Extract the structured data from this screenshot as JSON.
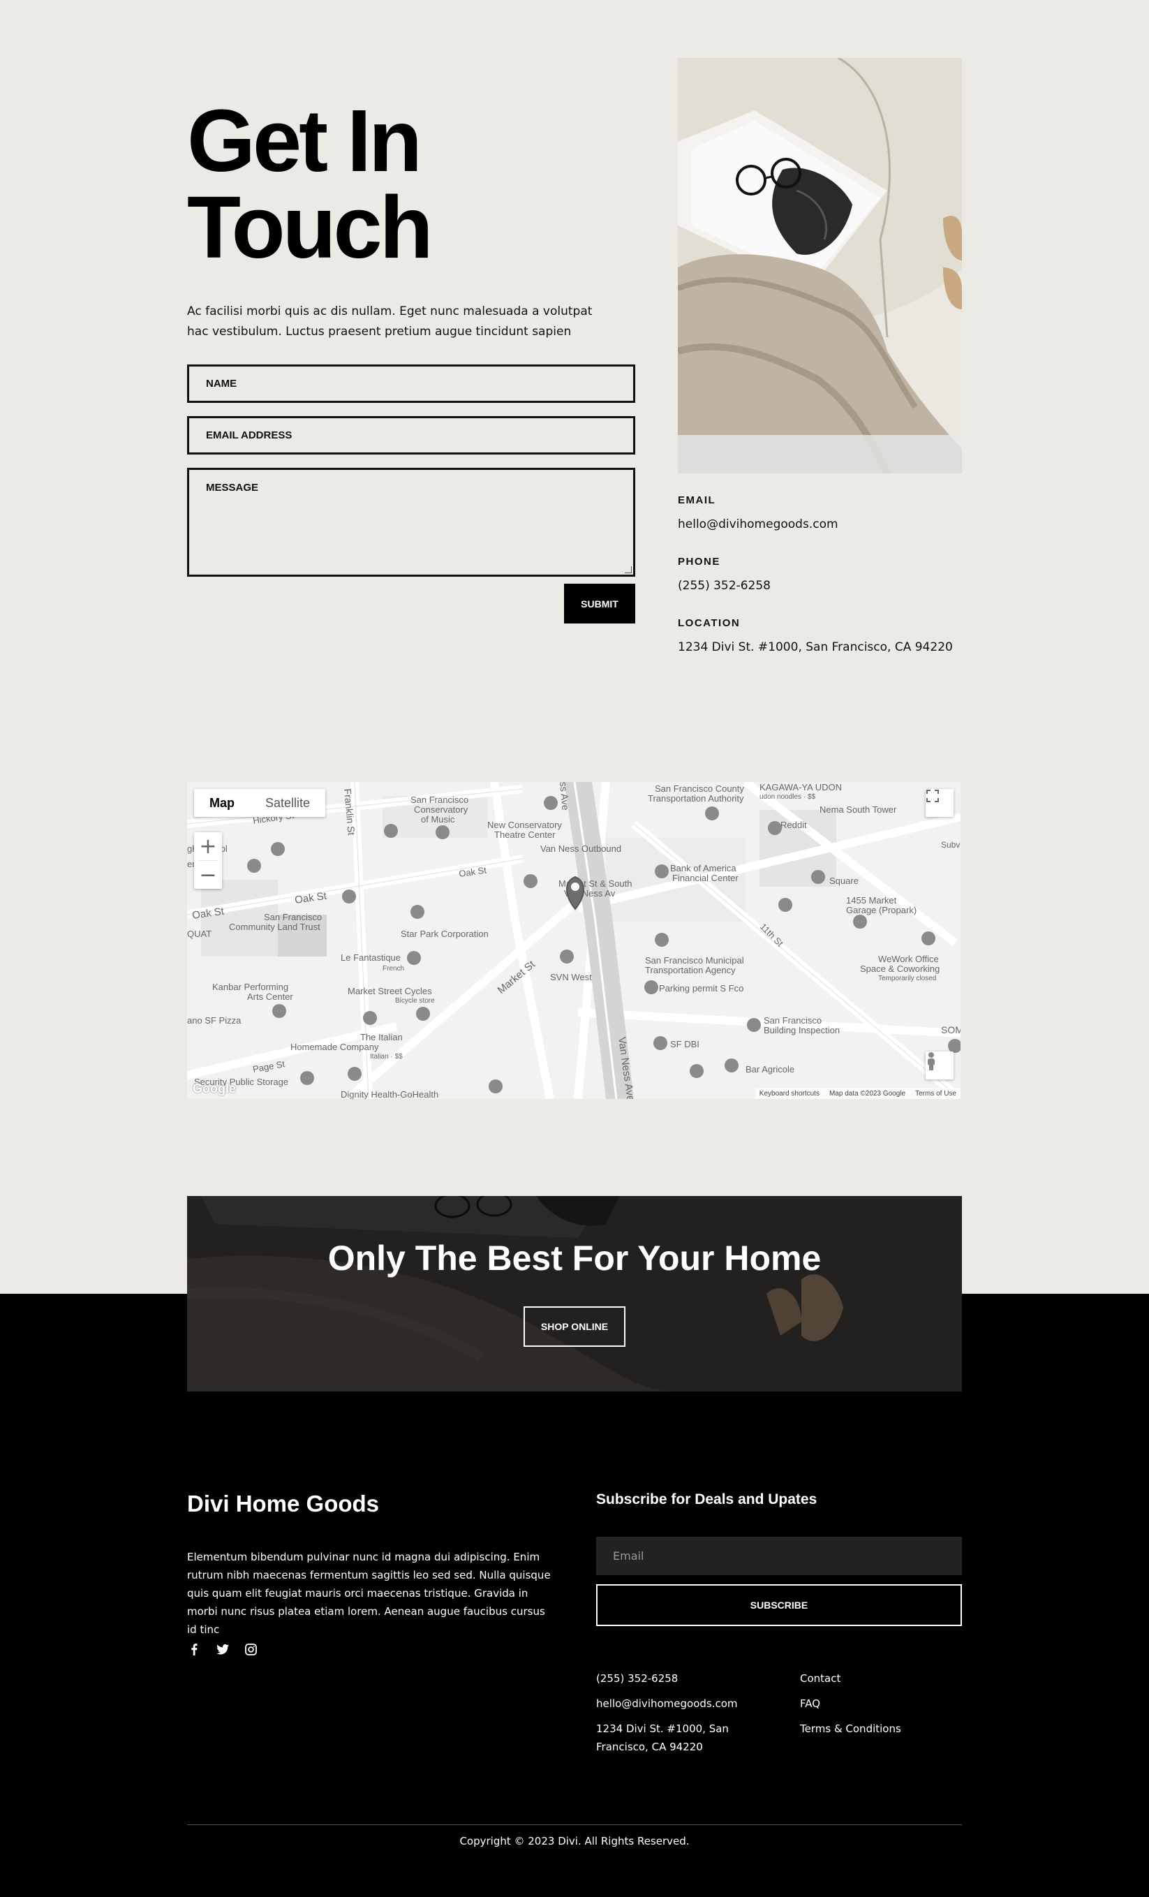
{
  "contact": {
    "title_line1": "Get In",
    "title_line2": "Touch",
    "intro": "Ac facilisi morbi quis ac dis nullam. Eget nunc malesuada a volutpat hac vestibulum. Luctus praesent pretium augue tincidunt sapien",
    "name_placeholder": "NAME",
    "email_placeholder": "EMAIL ADDRESS",
    "message_placeholder": "MESSAGE",
    "submit_label": "SUBMIT"
  },
  "info": {
    "email_label": "EMAIL",
    "email_value": "hello@divihomegoods.com",
    "phone_label": "PHONE",
    "phone_value": "(255) 352-6258",
    "location_label": "LOCATION",
    "location_value": "1234 Divi St. #1000, San Francisco, CA 94220"
  },
  "map": {
    "type_map": "Map",
    "type_satellite": "Satellite",
    "zoom_in": "+",
    "zoom_out": "−",
    "logo": "Google",
    "keyboard": "Keyboard shortcuts",
    "map_data": "Map data ©2023 Google",
    "terms": "Terms of Use",
    "labels": {
      "sf_conservatory": "San Francisco Conservatory of Music",
      "new_conservatory": "New Conservatory Theatre Center",
      "van_ness_outbound": "Van Ness Outbound",
      "sfcta": "San Francisco County Transportation Authority",
      "kagawa": "KAGAWA-YA UDON",
      "kagawa_sub": "udon noodles · $$",
      "reddit": "Reddit",
      "nema": "Nema South Tower",
      "hickory": "Hickory St",
      "high_school": "gh School",
      "american": "erican",
      "oak_st_1": "Oak St",
      "oak_st_2": "Oak St",
      "oak_st_3": "Oak St",
      "franklin": "Franklin St",
      "van_ness_ave": "Van Ness Ave",
      "ness_ave": "ss Ave",
      "market_south": "Market St & South Van Ness Av",
      "boa": "Bank of America Financial Center",
      "square": "Square",
      "market_garage": "1455 Market Garage (Propark)",
      "eleventh": "11th St",
      "clt": "San Francisco Community Land Trust",
      "star_park": "Star Park Corporation",
      "quat": "QUAT",
      "le_fantastique": "Le Fantastique",
      "french": "French",
      "market_st": "Market St",
      "svn_west": "SVN West",
      "sfmta": "San Francisco Municipal Transportation Agency",
      "parking_permit": "Parking permit S Fco",
      "wework": "WeWork Office Space & Coworking",
      "wework_sub": "Temporarily closed",
      "kanbar": "Kanbar Performing Arts Center",
      "market_cycles": "Market Street Cycles",
      "cycles_sub": "Bicycle store",
      "sf_pizza": "ano SF Pizza",
      "italian": "The Italian Homemade Company",
      "italian_sub": "Italian · $$",
      "sf_dbi": "SF DBI",
      "building_insp": "San Francisco Building Inspection",
      "bar_agricole": "Bar Agricole",
      "page_st": "Page St",
      "security_storage": "Security Public Storage",
      "dignity": "Dignity Health-GoHealth",
      "som": "SOM",
      "subv": "Subv"
    }
  },
  "cta": {
    "title": "Only The Best For Your Home",
    "button": "SHOP ONLINE"
  },
  "footer": {
    "brand": "Divi Home Goods",
    "about": "Elementum bibendum pulvinar nunc id magna dui adipiscing. Enim rutrum nibh maecenas fermentum sagittis leo sed sed. Nulla quisque quis quam elit feugiat mauris orci maecenas tristique. Gravida in morbi nunc risus platea etiam lorem. Aenean augue faucibus cursus id tinc",
    "subscribe_title": "Subscribe for Deals and Upates",
    "email_placeholder": "Email",
    "subscribe_button": "SUBSCRIBE",
    "phone": "(255) 352-6258",
    "email": "hello@divihomegoods.com",
    "address": "1234 Divi St. #1000, San Francisco, CA 94220",
    "link_contact": "Contact",
    "link_faq": "FAQ",
    "link_terms": "Terms & Conditions",
    "copyright": "Copyright © 2023 Divi. All Rights Reserved."
  },
  "icons": {
    "facebook": "facebook-icon",
    "twitter": "twitter-icon",
    "instagram": "instagram-icon"
  },
  "colors": {
    "page_bg": "#ebeae4",
    "footer_bg": "#000000",
    "accent": "#000000"
  }
}
